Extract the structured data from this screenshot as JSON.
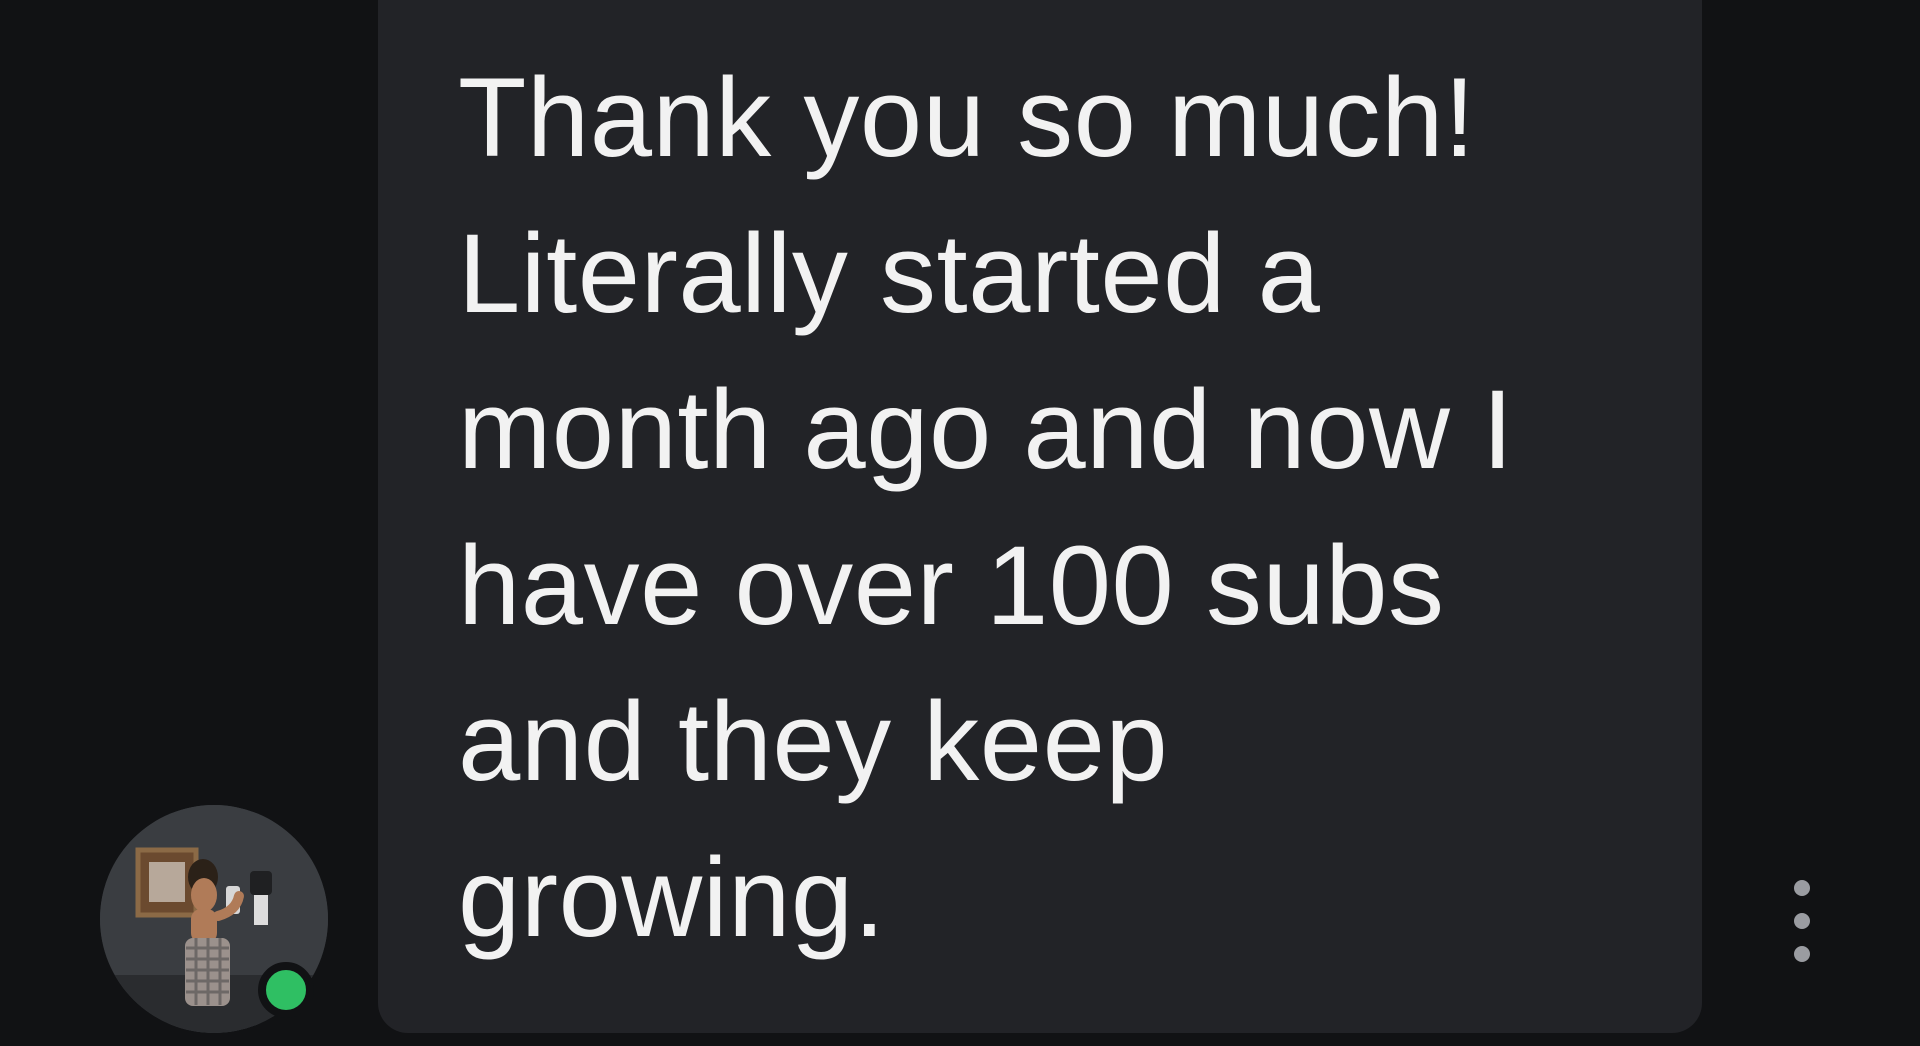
{
  "message": {
    "text": "Thank you so much! Literally started a month ago and now I have over 100 subs and they keep growing."
  },
  "sender": {
    "avatar_icon": "profile-photo-avatar",
    "status": "online",
    "status_color": "#2fbf63"
  },
  "actions": {
    "more_options_icon": "vertical-ellipsis-icon"
  },
  "colors": {
    "background": "#111214",
    "bubble": "#222327",
    "text": "#f2f2f2",
    "dots": "#9a9ca1"
  }
}
